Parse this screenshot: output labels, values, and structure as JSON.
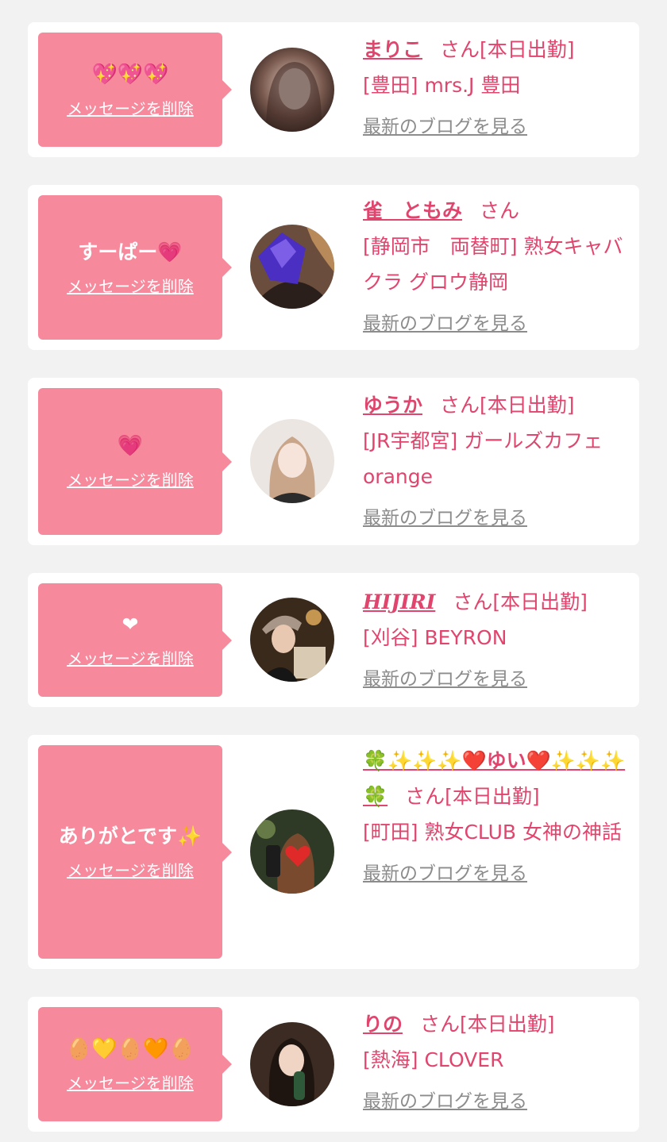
{
  "delete_label": "メッセージを削除",
  "blog_label": "最新のブログを見る",
  "san_suffix": "さん",
  "colors": {
    "background": "#f2f2f2",
    "bubble": "#f7899c",
    "accent": "#e0456d",
    "blog_link": "#8c8c8c"
  },
  "cards": [
    {
      "message": "💖💖💖",
      "name": "まりこ",
      "status": "[本日出勤]",
      "shop": "[豊田] mrs.J 豊田",
      "avatar_icon": "woman-portrait-photo"
    },
    {
      "message": "すーぱー💗",
      "name": "雀　ともみ",
      "status": "",
      "shop": "[静岡市　両替町] 熟女キャバクラ グロウ静岡",
      "avatar_icon": "woman-portrait-photo-purple-heart"
    },
    {
      "message": "💗",
      "name": "ゆうか",
      "status": "[本日出勤]",
      "shop": "[JR宇都宮] ガールズカフェ orange",
      "avatar_icon": "woman-portrait-photo"
    },
    {
      "message": "❤",
      "name": "HIJIRI",
      "status": "[本日出勤]",
      "shop": "[刈谷] BEYRON",
      "avatar_icon": "woman-portrait-photo"
    },
    {
      "message": "ありがとです✨",
      "name": "🍀✨✨✨❤️ゆい❤️✨✨✨🍀",
      "status": "[本日出勤]",
      "shop": "[町田] 熟女CLUB 女神の神話",
      "avatar_icon": "woman-portrait-photo-red-heart"
    },
    {
      "message": "🥚💛🥚🧡🥚",
      "name": "りの",
      "status": "[本日出勤]",
      "shop": "[熱海] CLOVER",
      "avatar_icon": "woman-portrait-photo"
    }
  ]
}
